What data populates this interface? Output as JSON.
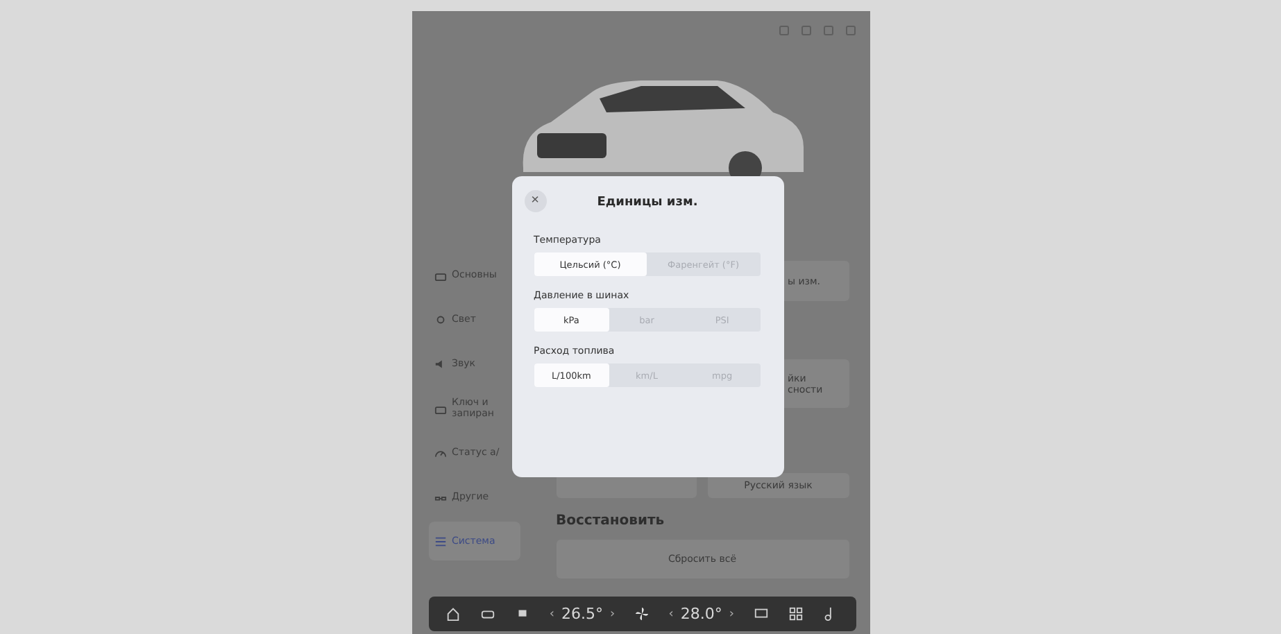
{
  "sidebar": {
    "items": [
      {
        "label": "Основны",
        "selected": false
      },
      {
        "label": "Свет",
        "selected": false
      },
      {
        "label": "Звук",
        "selected": false
      },
      {
        "label": "Ключ и запиран",
        "selected": false
      },
      {
        "label": "Статус а/",
        "selected": false
      },
      {
        "label": "Другие",
        "selected": false
      },
      {
        "label": "Система",
        "selected": true
      }
    ]
  },
  "content": {
    "cards": [
      "ы изм.",
      "йки сности"
    ],
    "language_button": "Русский язык",
    "restore": {
      "heading": "Восстановить",
      "button": "Сбросить всё"
    }
  },
  "dialog": {
    "title": "Единицы изм.",
    "close": "×",
    "groups": [
      {
        "label": "Температура",
        "options": [
          {
            "label": "Цельсий (°C)",
            "selected": true
          },
          {
            "label": "Фаренгейт (°F)",
            "selected": false
          }
        ]
      },
      {
        "label": "Давление в шинах",
        "options": [
          {
            "label": "kPa",
            "selected": true
          },
          {
            "label": "bar",
            "selected": false
          },
          {
            "label": "PSI",
            "selected": false
          }
        ]
      },
      {
        "label": "Расход топлива",
        "options": [
          {
            "label": "L/100km",
            "selected": true
          },
          {
            "label": "km/L",
            "selected": false
          },
          {
            "label": "mpg",
            "selected": false
          }
        ]
      }
    ]
  },
  "dock": {
    "left_temp": {
      "prev": "‹",
      "value": "26.5°",
      "next": "›"
    },
    "right_temp": {
      "prev": "‹",
      "value": "28.0°",
      "next": "›"
    }
  }
}
